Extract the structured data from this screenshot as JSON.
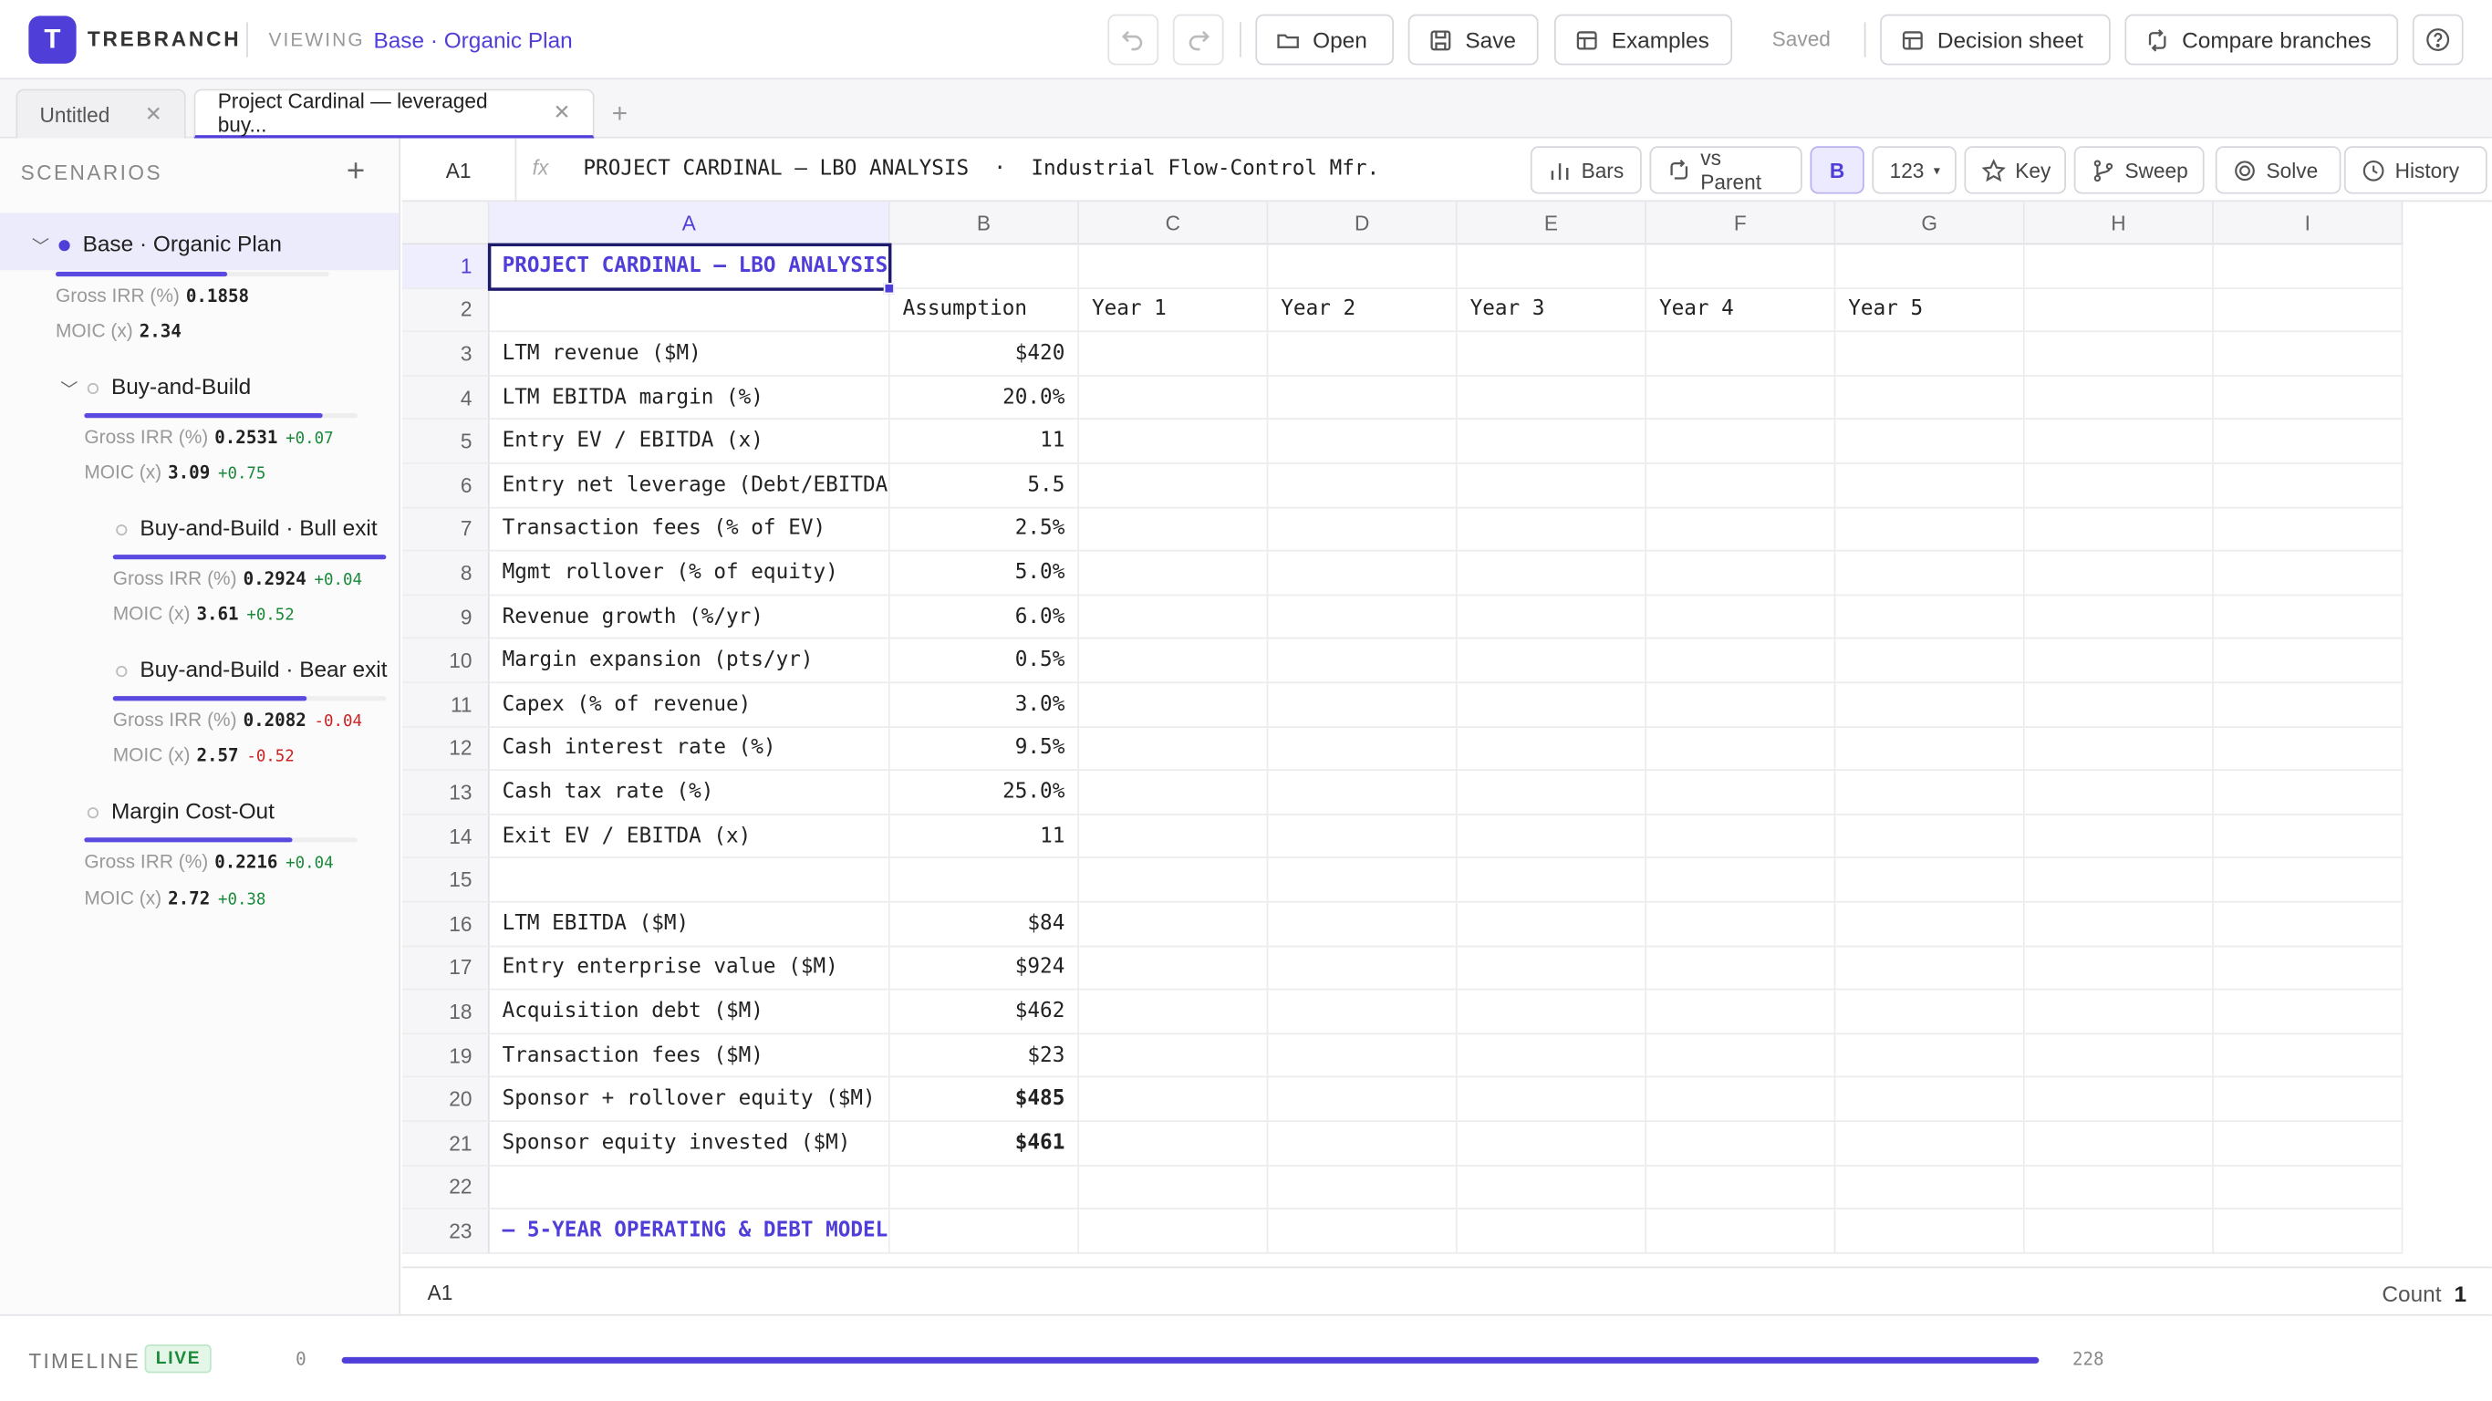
{
  "app": {
    "logo_letter": "T",
    "brand": "TREBRANCH",
    "viewing_label": "VIEWING",
    "viewing_name": "Base · Organic Plan"
  },
  "toolbar": {
    "open": "Open",
    "save": "Save",
    "examples": "Examples",
    "saved": "Saved",
    "decision_sheet": "Decision sheet",
    "compare": "Compare branches"
  },
  "tabs": [
    {
      "label": "Untitled",
      "active": false
    },
    {
      "label": "Project Cardinal — leveraged buy...",
      "active": true
    }
  ],
  "sidebar": {
    "title": "SCENARIOS",
    "scenarios": [
      {
        "name": "Base · Organic Plan",
        "irr_label": "Gross IRR (%)",
        "irr": "0.1858",
        "irr_delta": "",
        "moic_label": "MOIC (x)",
        "moic": "2.34",
        "moic_delta": "",
        "progress": 0.63
      },
      {
        "name": "Buy-and-Build",
        "irr_label": "Gross IRR (%)",
        "irr": "0.2531",
        "irr_delta": "+0.07",
        "moic_label": "MOIC (x)",
        "moic": "3.09",
        "moic_delta": "+0.75",
        "progress": 0.87
      },
      {
        "name": "Buy-and-Build · Bull exit",
        "irr_label": "Gross IRR (%)",
        "irr": "0.2924",
        "irr_delta": "+0.04",
        "moic_label": "MOIC (x)",
        "moic": "3.61",
        "moic_delta": "+0.52",
        "progress": 1.0
      },
      {
        "name": "Buy-and-Build · Bear exit",
        "irr_label": "Gross IRR (%)",
        "irr": "0.2082",
        "irr_delta": "-0.04",
        "moic_label": "MOIC (x)",
        "moic": "2.57",
        "moic_delta": "-0.52",
        "progress": 0.71
      },
      {
        "name": "Margin Cost-Out",
        "irr_label": "Gross IRR (%)",
        "irr": "0.2216",
        "irr_delta": "+0.04",
        "moic_label": "MOIC (x)",
        "moic": "2.72",
        "moic_delta": "+0.38",
        "progress": 0.76
      }
    ]
  },
  "formula_bar": {
    "cell_ref": "A1",
    "fx": "fx",
    "content": "PROJECT CARDINAL — LBO ANALYSIS  ·  Industrial Flow-Control Mfr.",
    "buttons": {
      "bars": "Bars",
      "vs_parent": "vs Parent",
      "bold": "B",
      "format": "123",
      "key": "Key",
      "sweep": "Sweep",
      "solve": "Solve",
      "history": "History"
    }
  },
  "grid": {
    "columns": [
      "A",
      "B",
      "C",
      "D",
      "E",
      "F",
      "G",
      "H",
      "I"
    ],
    "rows": [
      [
        "PROJECT CARDINAL — LBO ANALYSIS",
        "",
        "",
        "",
        "",
        "",
        ""
      ],
      [
        "",
        "Assumption",
        "Year 1",
        "Year 2",
        "Year 3",
        "Year 4",
        "Year 5"
      ],
      [
        "LTM revenue ($M)",
        "$420"
      ],
      [
        "LTM EBITDA margin (%)",
        "20.0%"
      ],
      [
        "Entry EV / EBITDA (x)",
        "11"
      ],
      [
        "Entry net leverage (Debt/EBITDA",
        "5.5"
      ],
      [
        "Transaction fees (% of EV)",
        "2.5%"
      ],
      [
        "Mgmt rollover (% of equity)",
        "5.0%"
      ],
      [
        "Revenue growth (%/yr)",
        "6.0%"
      ],
      [
        "Margin expansion (pts/yr)",
        "0.5%"
      ],
      [
        "Capex (% of revenue)",
        "3.0%"
      ],
      [
        "Cash interest rate (%)",
        "9.5%"
      ],
      [
        "Cash tax rate (%)",
        "25.0%"
      ],
      [
        "Exit EV / EBITDA (x)",
        "11"
      ],
      [
        "",
        ""
      ],
      [
        "LTM EBITDA ($M)",
        "$84"
      ],
      [
        "Entry enterprise value ($M)",
        "$924"
      ],
      [
        "Acquisition debt ($M)",
        "$462"
      ],
      [
        "Transaction fees ($M)",
        "$23"
      ],
      [
        "Sponsor + rollover equity ($M)",
        "$485"
      ],
      [
        "Sponsor equity invested ($M)",
        "$461"
      ],
      [
        "",
        ""
      ],
      [
        "— 5-YEAR OPERATING & DEBT MODEL",
        ""
      ]
    ]
  },
  "status_bar": {
    "cell_ref": "A1",
    "count_label": "Count",
    "count_value": "1"
  },
  "timeline": {
    "label": "TIMELINE",
    "live": "LIVE",
    "start": "0",
    "end": "228",
    "progress": 1.0
  },
  "colors": {
    "accent": "#4f3ed8",
    "positive": "#1a8a3a",
    "negative": "#cc2222"
  }
}
